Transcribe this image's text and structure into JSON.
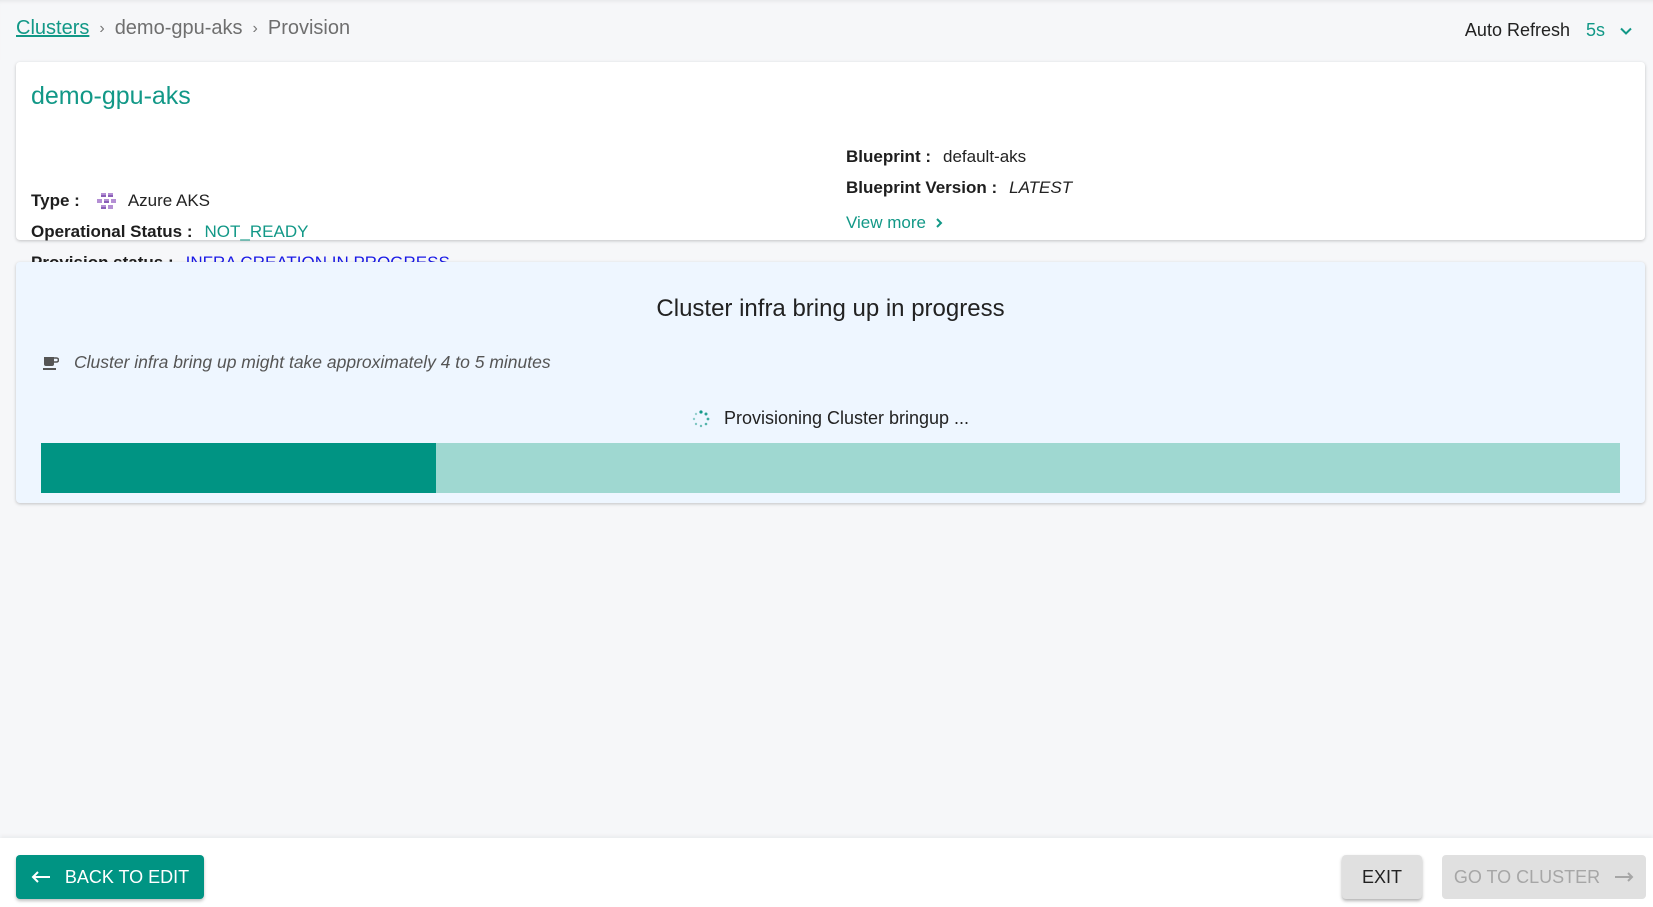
{
  "breadcrumb": {
    "items": [
      {
        "label": "Clusters",
        "link": true
      },
      {
        "label": "demo-gpu-aks",
        "link": false
      },
      {
        "label": "Provision",
        "link": false
      }
    ],
    "separator": "›"
  },
  "auto_refresh": {
    "label": "Auto Refresh",
    "value": "5s"
  },
  "cluster": {
    "name": "demo-gpu-aks",
    "type_label": "Type :",
    "type_value": "Azure AKS",
    "type_icon": "azure-aks-icon",
    "operational_status_label": "Operational Status :",
    "operational_status_value": "NOT_READY",
    "provision_status_label": "Provision status :",
    "provision_status_value": "INFRA CREATION IN PROGRESS",
    "blueprint_label": "Blueprint :",
    "blueprint_value": "default-aks",
    "blueprint_version_label": "Blueprint Version :",
    "blueprint_version_value": "LATEST",
    "view_more_label": "View more"
  },
  "progress": {
    "title": "Cluster infra bring up in progress",
    "note": "Cluster infra bring up might take approximately 4 to 5 minutes",
    "status_text": "Provisioning Cluster bringup ...",
    "percent": 25
  },
  "colors": {
    "accent": "#009483",
    "accent_text": "#129887",
    "progress_track": "#9fd8d1",
    "provision_status": "#1a1ae6"
  },
  "footer": {
    "back_label": "BACK TO EDIT",
    "exit_label": "EXIT",
    "go_label": "GO TO CLUSTER"
  }
}
